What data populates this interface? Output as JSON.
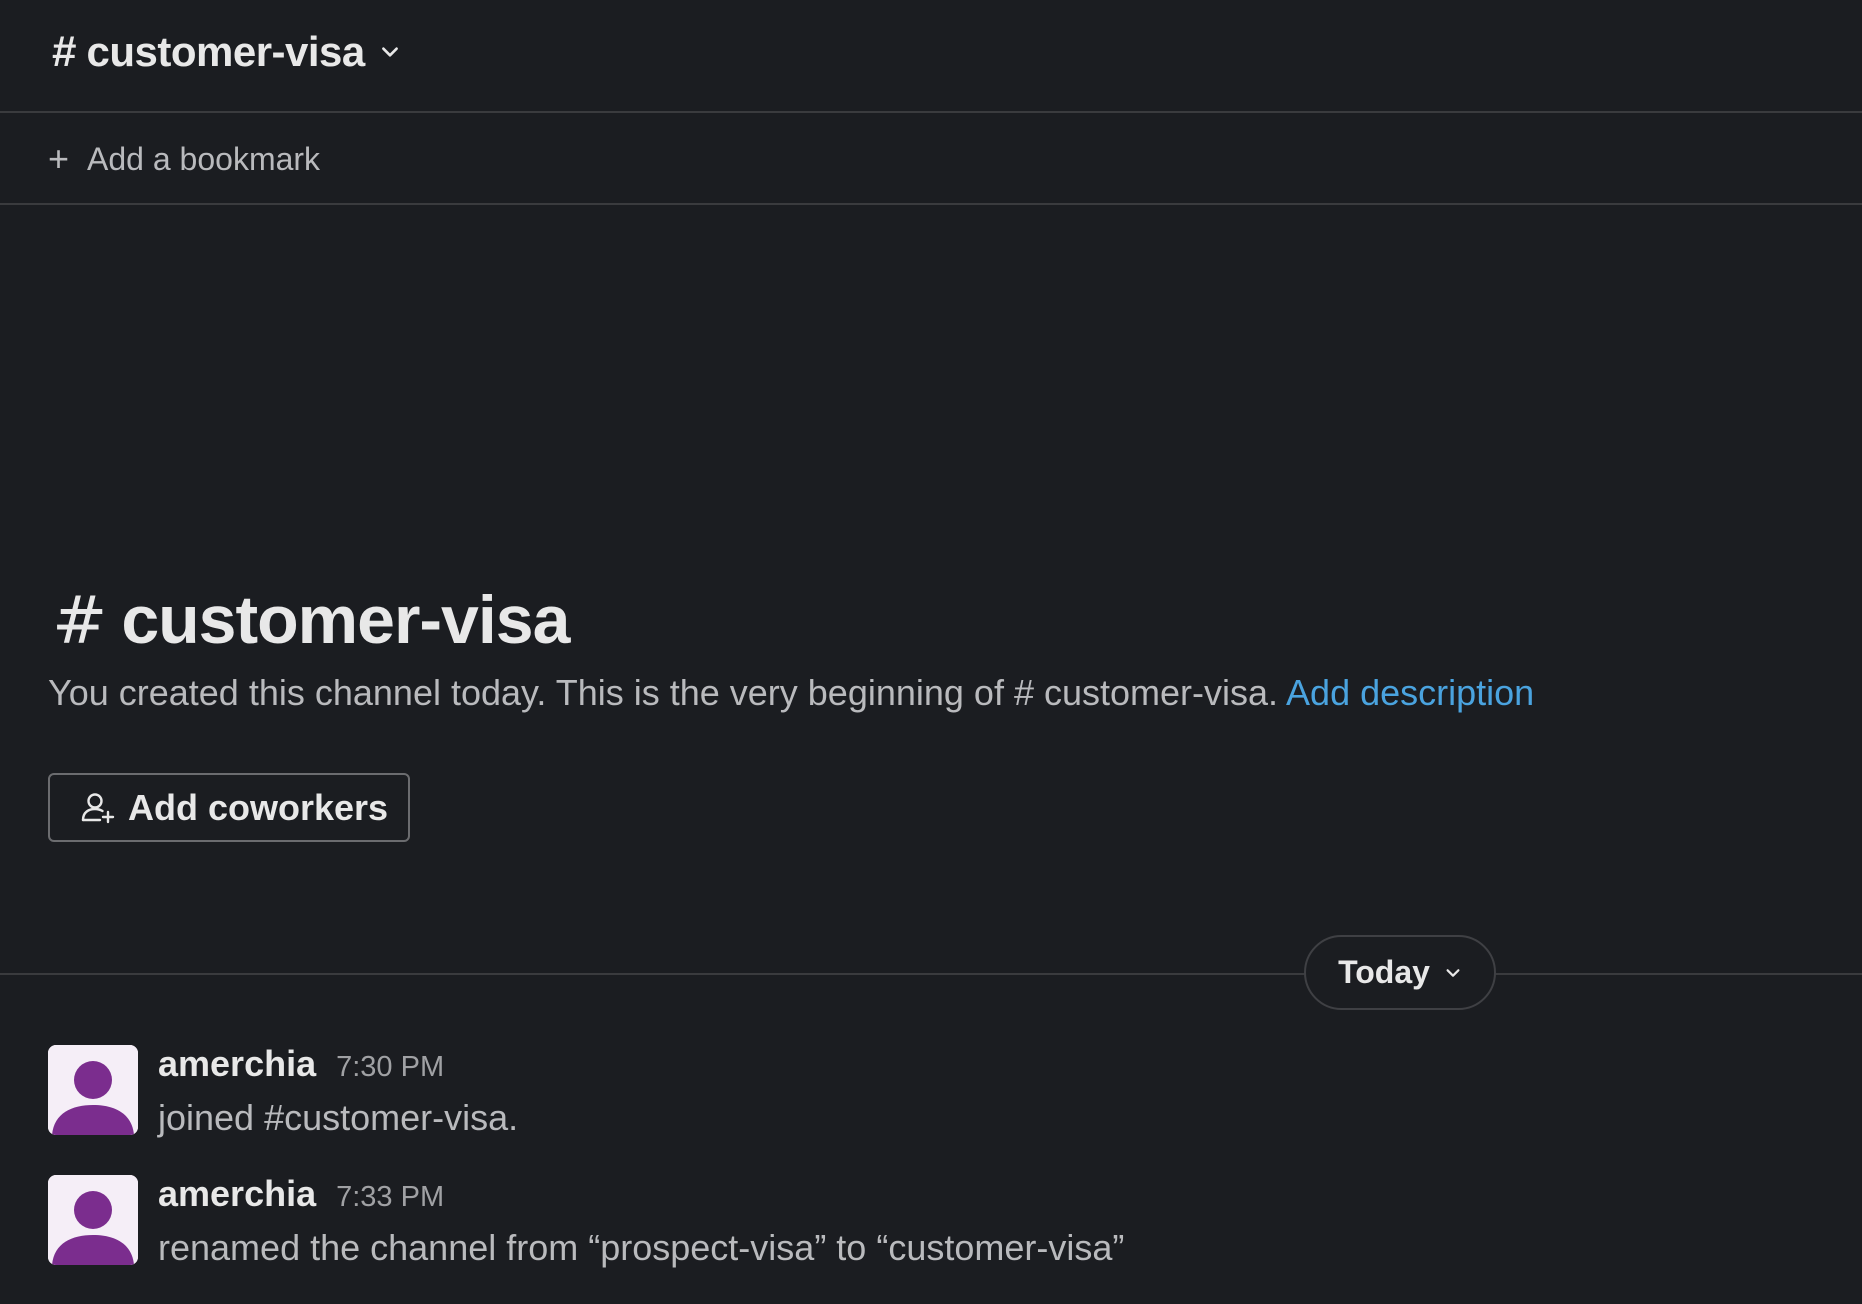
{
  "header": {
    "hash": "#",
    "channel_name": "customer-visa"
  },
  "bookmarks": {
    "add_label": "Add a bookmark"
  },
  "intro": {
    "hash": "#",
    "title": "customer-visa",
    "description": "You created this channel today. This is the very beginning of # customer-visa.",
    "add_description_link": "Add description",
    "add_coworkers_label": "Add coworkers"
  },
  "divider": {
    "date_label": "Today"
  },
  "messages": [
    {
      "author": "amerchia",
      "time": "7:30 PM",
      "text": "joined #customer-visa."
    },
    {
      "author": "amerchia",
      "time": "7:33 PM",
      "text": "renamed the channel from “prospect-visa” to “customer-visa”"
    }
  ],
  "colors": {
    "background": "#1b1d21",
    "link": "#4aa3df",
    "avatar_figure": "#7b2d8e",
    "avatar_bg": "#f5eef7"
  },
  "icons": {
    "header_chevron": "chevron-down-icon",
    "bookmark_plus": "plus-icon",
    "add_coworkers": "add-person-icon",
    "date_chevron": "chevron-down-icon",
    "avatar": "default-user-avatar-icon"
  }
}
